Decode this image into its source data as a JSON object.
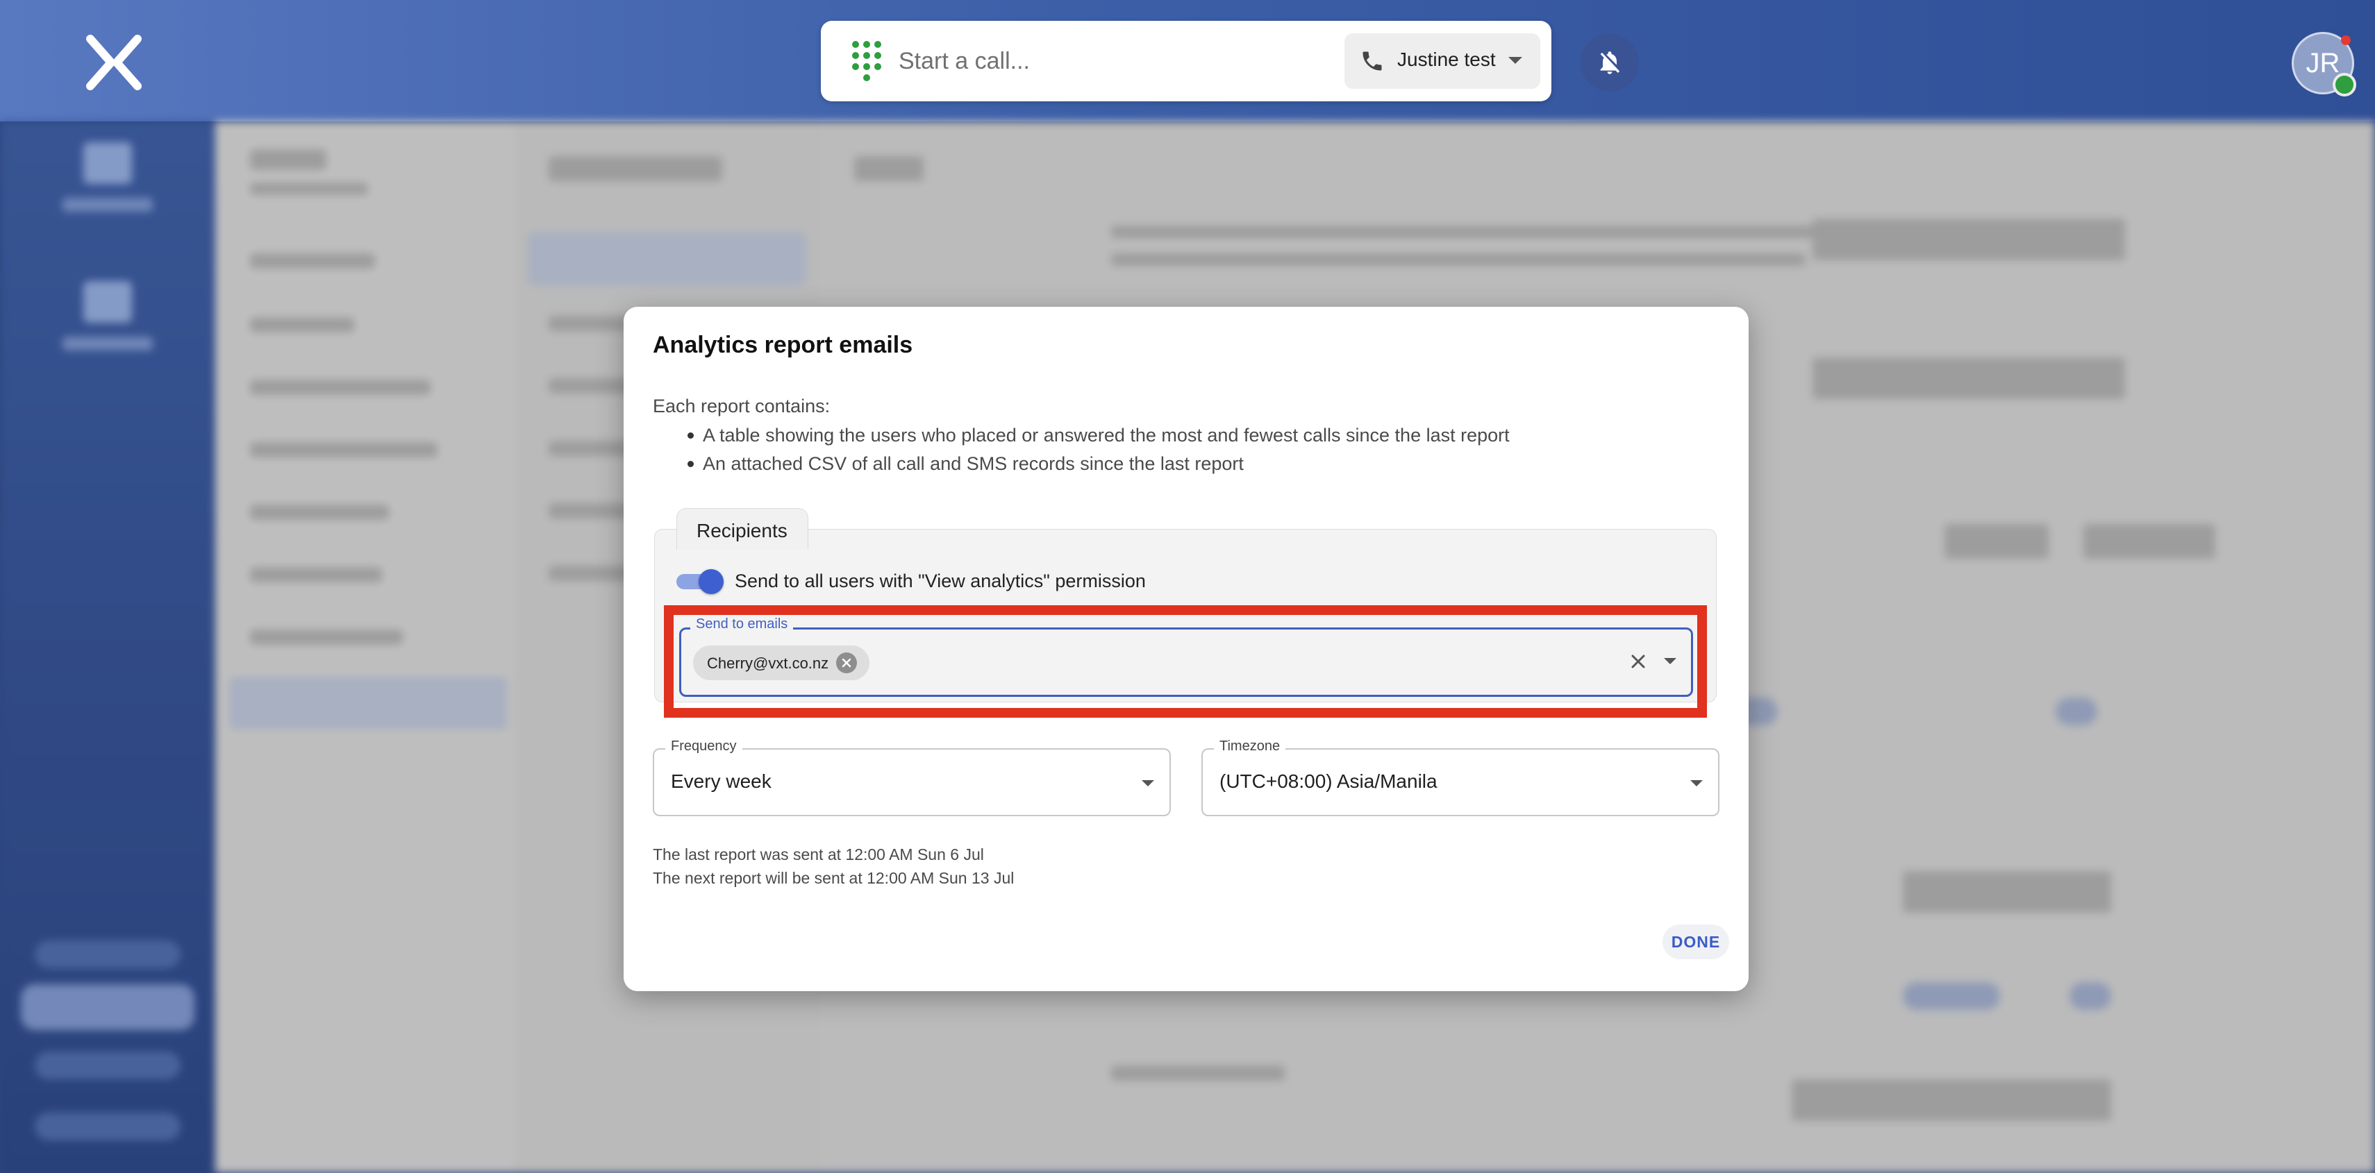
{
  "topbar": {
    "call_placeholder": "Start a call...",
    "caller_name": "Justine test",
    "avatar_initials": "JR"
  },
  "dialog": {
    "title": "Analytics report emails",
    "intro": "Each report contains:",
    "bullets": [
      "A table showing the users who placed or answered the most and fewest calls since the last report",
      "An attached CSV of all call and SMS records since the last report"
    ],
    "recipients": {
      "tab_label": "Recipients",
      "toggle_label": "Send to all users with \"View analytics\" permission",
      "toggle_on": true,
      "emails_label": "Send to emails",
      "emails": [
        "Cherry@vxt.co.nz"
      ]
    },
    "frequency": {
      "label": "Frequency",
      "value": "Every week"
    },
    "timezone": {
      "label": "Timezone",
      "value": "(UTC+08:00) Asia/Manila"
    },
    "schedule": {
      "last": "The last report was sent at 12:00 AM Sun 6 Jul",
      "next": "The next report will be sent at 12:00 AM Sun 13 Jul"
    },
    "done_label": "DONE"
  },
  "colors": {
    "accent": "#3f5fbf",
    "highlight_outline": "#e0321e",
    "dialpad_green": "#2e9e3e"
  },
  "icons": [
    "x-logo-icon",
    "dialpad-icon",
    "phone-icon",
    "chevron-down-icon",
    "bell-off-icon",
    "close-icon"
  ]
}
